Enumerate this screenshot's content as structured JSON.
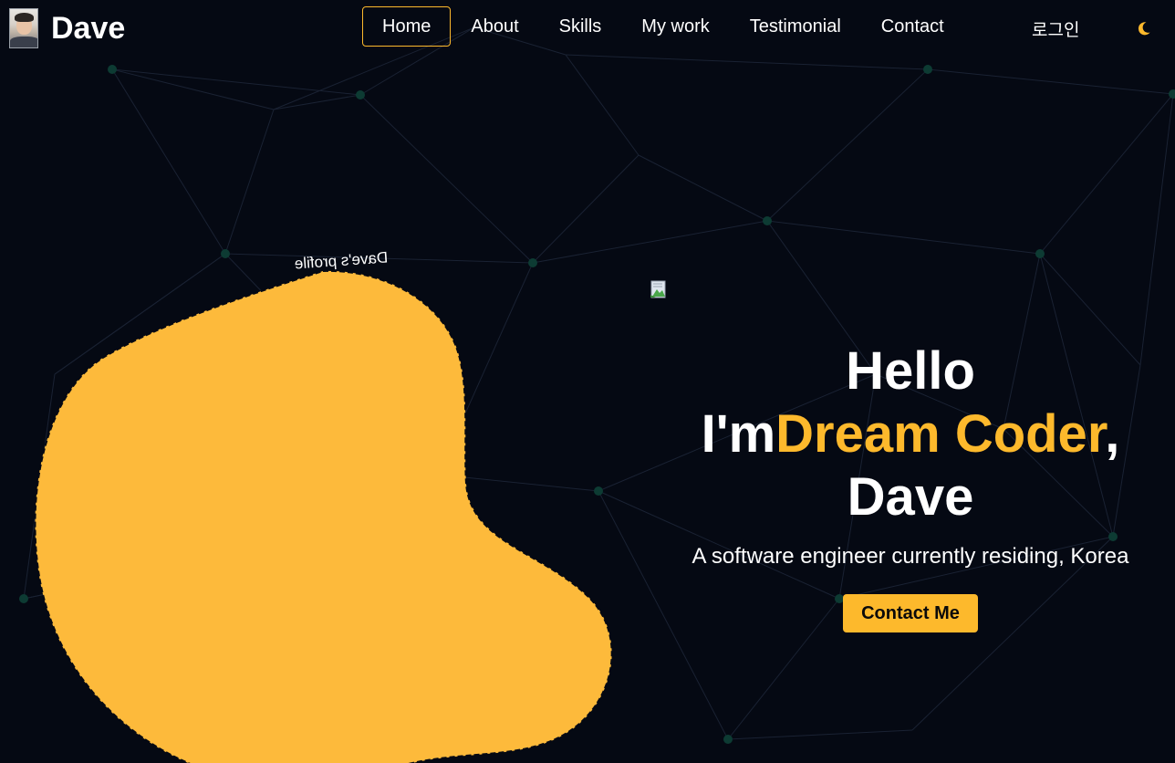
{
  "brand": {
    "name": "Dave"
  },
  "nav": {
    "items": [
      {
        "label": "Home",
        "active": true
      },
      {
        "label": "About",
        "active": false
      },
      {
        "label": "Skills",
        "active": false
      },
      {
        "label": "My work",
        "active": false
      },
      {
        "label": "Testimonial",
        "active": false
      },
      {
        "label": "Contact",
        "active": false
      }
    ]
  },
  "header": {
    "login_label": "로그인",
    "theme_icon": "crescent-moon-icon"
  },
  "hero": {
    "profile_caption": "Dave's profile",
    "title_line1": "Hello",
    "title_prefix": "I'm",
    "title_accent": "Dream Coder",
    "title_suffix": ",",
    "title_line3": "Dave",
    "subtitle": "A software engineer currently residing, Korea",
    "cta_label": "Contact Me"
  },
  "colors": {
    "background": "#050913",
    "accent": "#fdb92c",
    "network_line": "#1a2233",
    "network_node": "#0d3b33"
  }
}
